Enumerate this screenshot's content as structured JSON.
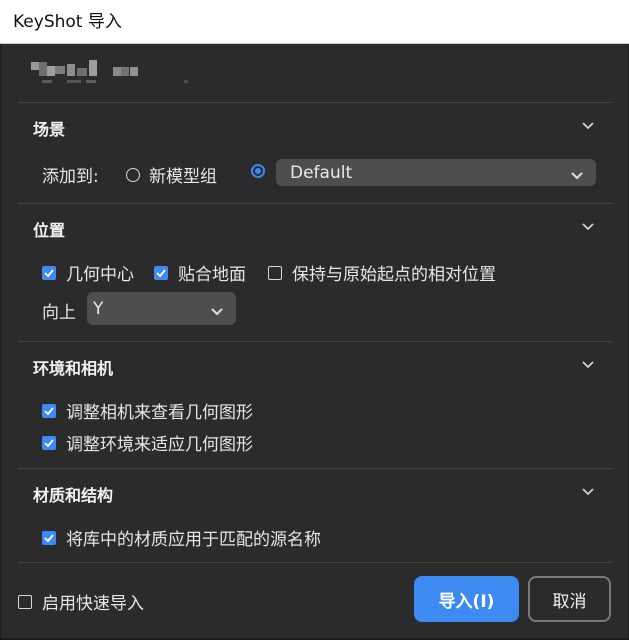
{
  "window": {
    "title": "KeyShot 导入"
  },
  "sections": {
    "scene": {
      "title": "场景",
      "add_to_label": "添加到:",
      "new_group_label": "新模型组",
      "group_select_value": "Default"
    },
    "position": {
      "title": "位置",
      "geometry_center": "几何中心",
      "snap_to_ground": "贴合地面",
      "keep_relative": "保持与原始起点的相对位置",
      "up_label": "向上",
      "up_value": "Y"
    },
    "environment_camera": {
      "title": "环境和相机",
      "adjust_camera": "调整相机来查看几何图形",
      "adjust_environment": "调整环境来适应几何图形"
    },
    "materials": {
      "title": "材质和结构",
      "apply_library": "将库中的材质应用于匹配的源名称"
    }
  },
  "footer": {
    "quick_import_label": "启用快速导入",
    "import_button": "导入(I)",
    "cancel_button": "取消"
  },
  "colors": {
    "accent": "#3d8bf2",
    "background": "#2b2b2b"
  },
  "icons": [
    "chevron-down-icon",
    "checkbox-checked-icon",
    "checkbox-empty-icon",
    "radio-icon"
  ]
}
